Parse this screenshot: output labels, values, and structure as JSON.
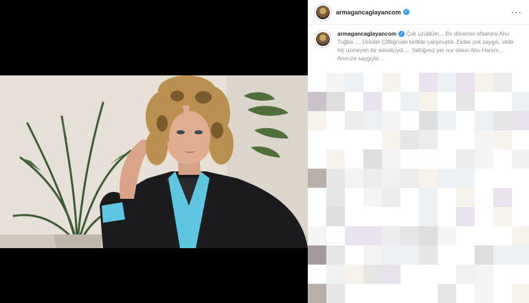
{
  "post": {
    "username": "armagancaglayancom",
    "caption": "Çok üzüldüm... Bir dönemin efsanesi Ahu Tuğba .... Ünlüler Çiftliği'nde birlikte çalışmıştık. Ekibe çok saygılı, ekibi hiç üzmeyen bir sanatçıydı ... Yattığınız yer nur olsun Ahu Hanım... Anınıza saygıyla ..."
  },
  "icons": {
    "verified": "verified-badge-icon",
    "more": "more-options-icon"
  },
  "colors": {
    "verified": "#3897f0",
    "shirt": "#5ec6e0",
    "jacket": "#1b1b1d"
  }
}
